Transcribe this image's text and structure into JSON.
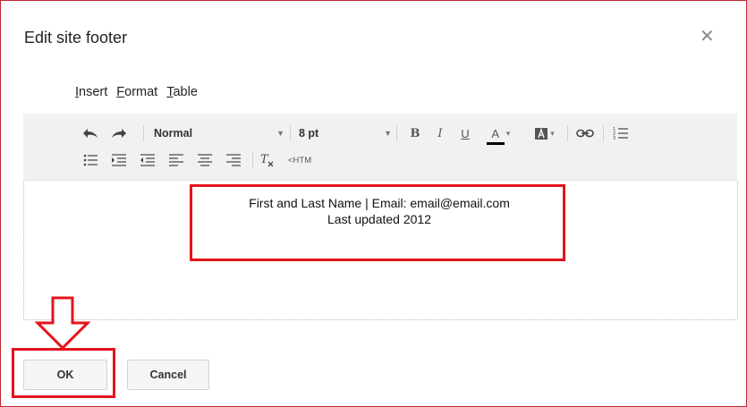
{
  "dialog": {
    "title": "Edit site footer",
    "close_icon": "close-icon"
  },
  "menu": {
    "items": [
      {
        "label": "Insert"
      },
      {
        "label": "Format"
      },
      {
        "label": "Table"
      }
    ]
  },
  "toolbar": {
    "style_select": "Normal",
    "size_select": "8 pt",
    "bold_glyph": "B",
    "italic_glyph": "I",
    "underline_glyph": "U",
    "text_color_glyph": "A",
    "html_label": "<HTM"
  },
  "editor": {
    "line1": "First and Last Name | Email: email@email.com",
    "line2": "Last updated 2012"
  },
  "buttons": {
    "ok": "OK",
    "cancel": "Cancel"
  },
  "colors": {
    "highlight": "#e3141c",
    "toolbar_bg": "#f1f1f1",
    "frame": "#c0272d"
  }
}
